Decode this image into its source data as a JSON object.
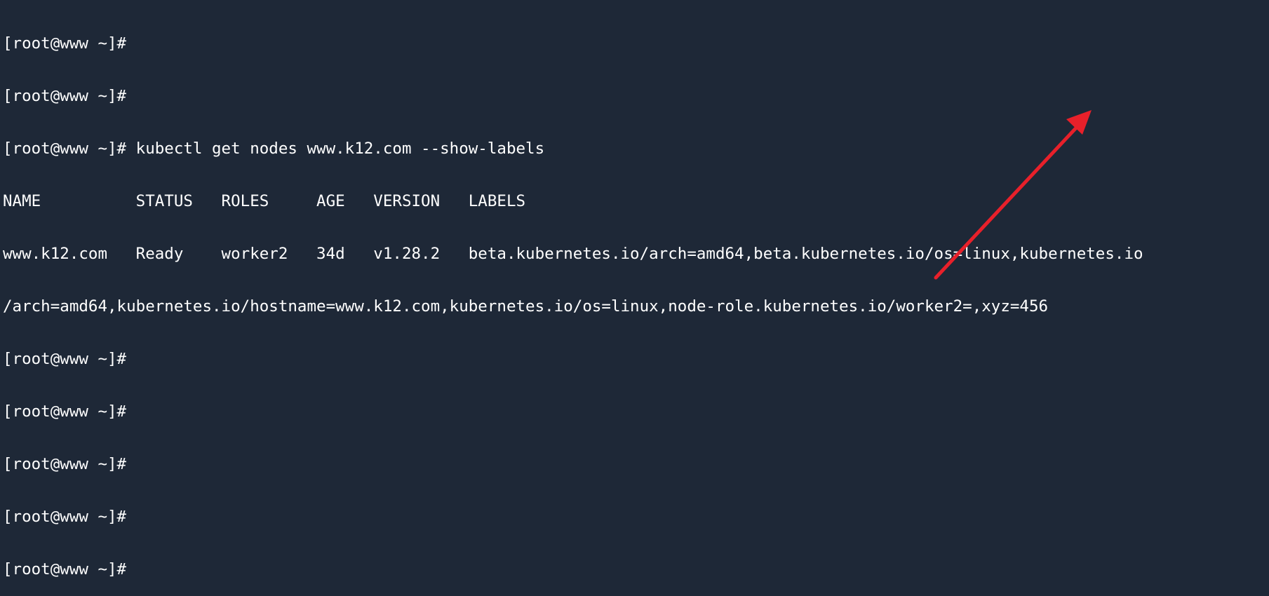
{
  "terminal": {
    "lines": [
      "[root@www ~]#",
      "[root@www ~]#",
      "[root@www ~]# kubectl get nodes www.k12.com --show-labels",
      "NAME          STATUS   ROLES     AGE   VERSION   LABELS",
      "www.k12.com   Ready    worker2   34d   v1.28.2   beta.kubernetes.io/arch=amd64,beta.kubernetes.io/os=linux,kubernetes.io",
      "/arch=amd64,kubernetes.io/hostname=www.k12.com,kubernetes.io/os=linux,node-role.kubernetes.io/worker2=,xyz=456",
      "[root@www ~]#",
      "[root@www ~]#",
      "[root@www ~]#",
      "[root@www ~]#",
      "[root@www ~]#"
    ]
  },
  "colors": {
    "background": "#1e2837",
    "text": "#ffffff",
    "annotation_arrow": "#e8202a"
  },
  "annotation": {
    "icon": "red-arrow-icon"
  }
}
